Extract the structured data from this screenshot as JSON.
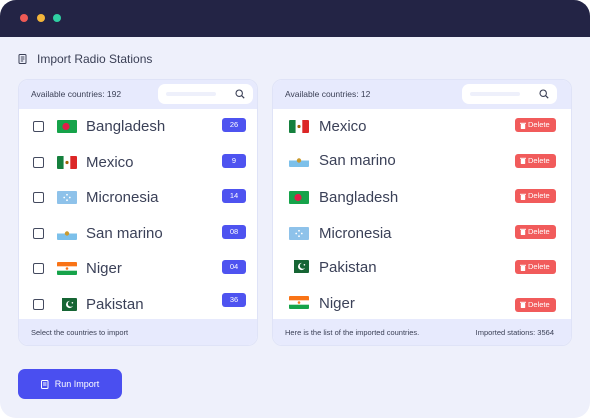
{
  "window": {
    "controls": [
      "close",
      "minimize",
      "maximize"
    ]
  },
  "page": {
    "title": "Import Radio Stations",
    "icon": "radio-list-icon"
  },
  "available": {
    "header_label": "Available countries: 192",
    "search_placeholder": "",
    "rows": [
      {
        "name": "Bangladesh",
        "badge": "26",
        "flag": "bangladesh",
        "checked": false
      },
      {
        "name": "Mexico",
        "badge": "9",
        "flag": "mexico",
        "checked": false
      },
      {
        "name": "Micronesia",
        "badge": "14",
        "flag": "micronesia",
        "checked": false
      },
      {
        "name": "San marino",
        "badge": "08",
        "flag": "san-marino",
        "checked": false
      },
      {
        "name": "Niger",
        "badge": "04",
        "flag": "niger",
        "checked": false
      },
      {
        "name": "Pakistan",
        "badge": "36",
        "flag": "pakistan",
        "checked": false
      }
    ],
    "footer_text": "Select the countries to import"
  },
  "imported": {
    "header_label": "Available countries: 12",
    "search_placeholder": "",
    "rows": [
      {
        "name": "Mexico",
        "flag": "mexico"
      },
      {
        "name": "San marino",
        "flag": "san-marino"
      },
      {
        "name": "Bangladesh",
        "flag": "bangladesh"
      },
      {
        "name": "Micronesia",
        "flag": "micronesia"
      },
      {
        "name": "Pakistan",
        "flag": "pakistan"
      },
      {
        "name": "Niger",
        "flag": "niger"
      }
    ],
    "delete_label": "Delete",
    "footer_text": "Here is the list of the imported countries.",
    "footer_stats": "Imported stations: 3564"
  },
  "actions": {
    "run_import_label": "Run Import",
    "run_import_icon": "document-icon"
  },
  "colors": {
    "titlebar": "#232445",
    "background": "#eef0fb",
    "panel_header": "#e7eafd",
    "accent": "#4a4ff0",
    "badge": "#4e53f0",
    "danger": "#f15b5b"
  }
}
